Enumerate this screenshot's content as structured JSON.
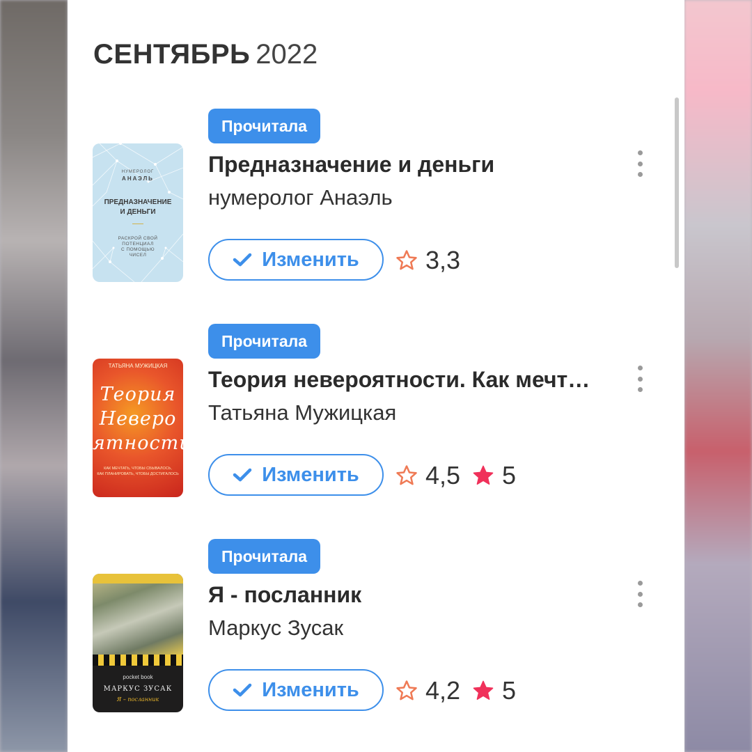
{
  "month": {
    "name": "СЕНТЯБРЬ",
    "year": "2022"
  },
  "books": [
    {
      "status": "Прочитала",
      "title": "Предназначение и деньги",
      "author": "нумеролог Анаэль",
      "edit_label": "Изменить",
      "avg_rating": "3,3",
      "cover": {
        "author_top": "НУМЕРОЛОГ",
        "author": "АНАЭЛЬ",
        "title_line1": "ПРЕДНАЗНАЧЕНИЕ",
        "title_line2": "И ДЕНЬГИ",
        "subtitle_line1": "РАСКРОЙ СВОЙ",
        "subtitle_line2": "ПОТЕНЦИАЛ",
        "subtitle_line3": "С ПОМОЩЬЮ",
        "subtitle_line4": "ЧИСЕЛ"
      }
    },
    {
      "status": "Прочитала",
      "title": "Теория невероятности. Как мечт…",
      "author": "Татьяна Мужицкая",
      "edit_label": "Изменить",
      "avg_rating": "4,5",
      "my_rating": "5",
      "cover": {
        "author": "ТАТЬЯНА МУЖИЦКАЯ",
        "title_line1": "Теория",
        "title_line2": "Неверо",
        "title_line3": "ятности",
        "subtitle_line1": "КАК МЕЧТАТЬ, ЧТОБЫ СБЫВАЛОСЬ,",
        "subtitle_line2": "КАК ПЛАНИРОВАТЬ, ЧТОБЫ ДОСТИГАЛОСЬ"
      }
    },
    {
      "status": "Прочитала",
      "title": "Я - посланник",
      "author": "Маркус Зусак",
      "edit_label": "Изменить",
      "avg_rating": "4,2",
      "my_rating": "5",
      "cover": {
        "brand": "pocket book",
        "author": "МАРКУС ЗУСАК",
        "title": "Я – посланник"
      }
    }
  ],
  "colors": {
    "accent": "#3d8fea",
    "star_outline": "#ef7a55",
    "star_filled": "#f0315a"
  },
  "icons": {
    "check": "check-icon",
    "more": "more-vertical-icon",
    "star_outline": "star-outline-icon",
    "star_filled": "star-filled-icon"
  }
}
